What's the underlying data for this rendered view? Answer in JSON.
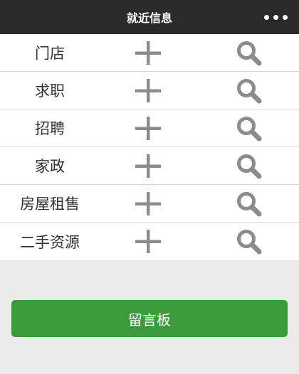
{
  "header": {
    "title": "就近信息"
  },
  "items": [
    {
      "label": "门店"
    },
    {
      "label": "求职"
    },
    {
      "label": "招聘"
    },
    {
      "label": "家政"
    },
    {
      "label": "房屋租售"
    },
    {
      "label": "二手资源"
    }
  ],
  "icons": {
    "more": "more-dots-icon",
    "add": "plus-icon",
    "search": "search-icon"
  },
  "message_board": {
    "label": "留言板"
  },
  "colors": {
    "header_bg": "#2a2a2a",
    "button_green": "#3a9b3a",
    "icon_gray": "#8c8c8c",
    "page_bg": "#ebebeb"
  }
}
